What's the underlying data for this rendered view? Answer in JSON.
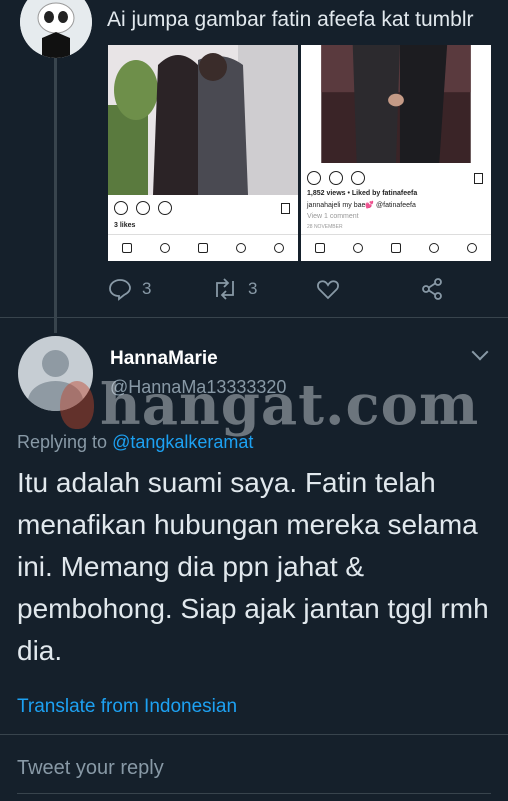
{
  "parent_tweet": {
    "text": "Ai jumpa gambar fatin afeefa kat tumblr",
    "images": [
      {
        "likes": "3 likes"
      },
      {
        "views": "1,852 views • Liked by fatinafeefa",
        "caption": "jannahajeli my bae💕 @fatinafeefa",
        "comments": "View 1 comment",
        "date": "28 NOVEMBER"
      }
    ],
    "actions": {
      "reply_count": "3",
      "retweet_count": "3"
    }
  },
  "reply_tweet": {
    "display_name": "HannaMarie",
    "handle": "@HannaMa13333320",
    "replying_prefix": "Replying to",
    "replying_to": "@tangkalkeramat",
    "text": "Itu adalah suami saya. Fatin telah menafikan hubungan mereka selama ini. Memang dia ppn jahat & pembohong. Siap ajak jantan tggl rmh dia.",
    "translate_label": "Translate from Indonesian"
  },
  "watermark": {
    "text": "hangat.com"
  },
  "compose": {
    "placeholder": "Tweet your reply"
  },
  "colors": {
    "background": "#15202b",
    "accent": "#1da1f2",
    "muted": "#8899a6"
  }
}
